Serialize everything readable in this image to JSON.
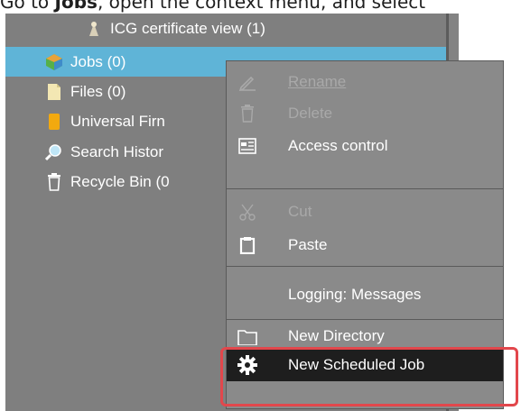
{
  "instruction": {
    "prefix": "Go to ",
    "bold": "Jobs",
    "suffix": ", open the context menu, and select"
  },
  "tree": {
    "items": [
      {
        "label": "ICG certificate view (1)",
        "icon": "certificate-icon"
      },
      {
        "label": "Jobs (0)",
        "icon": "jobs-icon",
        "selected": true
      },
      {
        "label": "Files (0)",
        "icon": "file-icon"
      },
      {
        "label": "Universal Firn",
        "icon": "firmware-icon"
      },
      {
        "label": "Search Histor",
        "icon": "search-icon"
      },
      {
        "label": "Recycle Bin (0",
        "icon": "trash-icon"
      }
    ]
  },
  "menu": {
    "rename": "Rename",
    "delete": "Delete",
    "access_control": "Access control",
    "cut": "Cut",
    "paste": "Paste",
    "logging": "Logging: Messages",
    "new_directory": "New Directory",
    "new_scheduled_job": "New Scheduled Job"
  },
  "colors": {
    "selected_row": "#5fb4d7",
    "panel": "#7f7f7f",
    "highlight": "#1e1e1e",
    "focus_ring": "#e2474c"
  }
}
